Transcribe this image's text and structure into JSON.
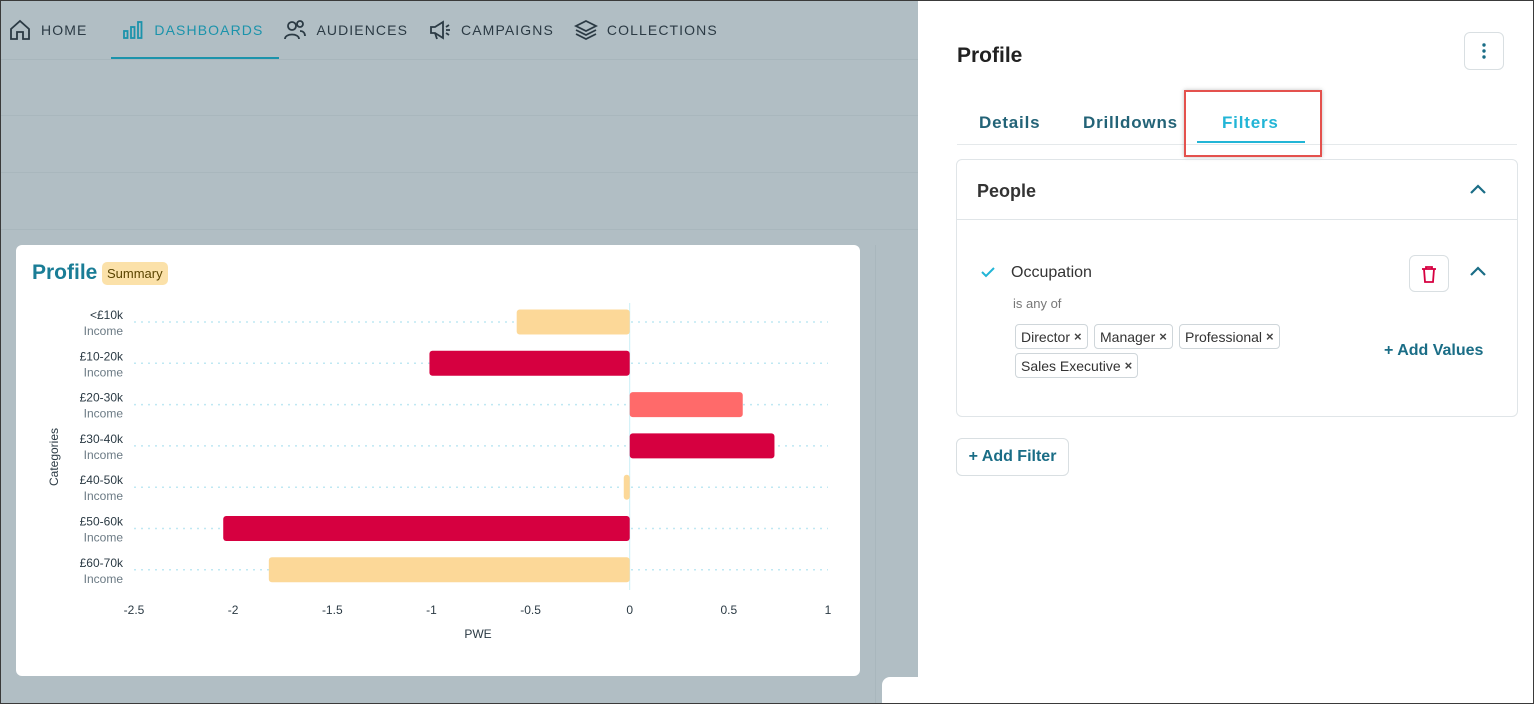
{
  "nav": {
    "items": [
      {
        "label": "HOME",
        "icon": "home-icon"
      },
      {
        "label": "DASHBOARDS",
        "icon": "bar-chart-icon",
        "active": true
      },
      {
        "label": "AUDIENCES",
        "icon": "people-icon"
      },
      {
        "label": "CAMPAIGNS",
        "icon": "megaphone-icon"
      },
      {
        "label": "COLLECTIONS",
        "icon": "layers-icon"
      }
    ]
  },
  "card": {
    "title": "Profile",
    "badge": "Summary"
  },
  "chart_data": {
    "type": "bar",
    "orientation": "horizontal",
    "categories": [
      [
        "<£10k",
        "Income"
      ],
      [
        "£10-20k",
        "Income"
      ],
      [
        "£20-30k",
        "Income"
      ],
      [
        "£30-40k",
        "Income"
      ],
      [
        "£40-50k",
        "Income"
      ],
      [
        "£50-60k",
        "Income"
      ],
      [
        "£60-70k",
        "Income"
      ]
    ],
    "values": [
      -0.57,
      -1.01,
      0.57,
      0.73,
      -0.03,
      -2.05,
      -1.82
    ],
    "colors": [
      "#fcd898",
      "#d60040",
      "#ff6a6a",
      "#d60040",
      "#fcd898",
      "#d60040",
      "#fcd898"
    ],
    "xlabel": "PWE",
    "ylabel": "Categories",
    "xlim": [
      -2.5,
      1
    ],
    "xticks": [
      "-2.5",
      "-2",
      "-1.5",
      "-1",
      "-0.5",
      "0",
      "0.5",
      "1"
    ],
    "grid": "horizontal-dotted"
  },
  "panel": {
    "title": "Profile",
    "menu_icon": "kebab-menu-icon",
    "tabs": [
      "Details",
      "Drilldowns",
      "Filters"
    ],
    "active_tab": "Filters",
    "section": {
      "title": "People",
      "filter": {
        "label": "Occupation",
        "operator": "is any of",
        "values": [
          "Director",
          "Manager",
          "Professional",
          "Sales Executive"
        ],
        "remove_glyph": "×"
      },
      "add_values": "+ Add Values"
    },
    "add_filter": "+ Add Filter"
  },
  "colors": {
    "accent": "#1b93ab",
    "tab_active": "#22b5d6",
    "danger": "#d60040",
    "highlight_box": "#e4514d"
  }
}
